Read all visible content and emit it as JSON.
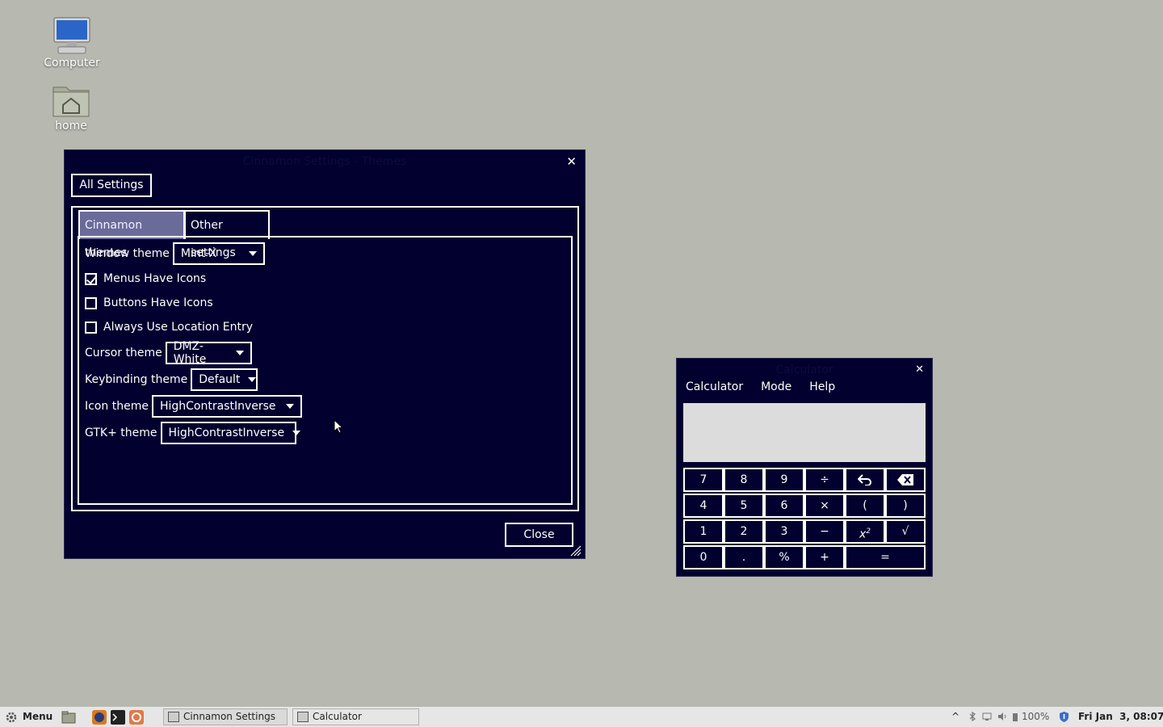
{
  "desktop": {
    "icons": [
      {
        "label": "Computer",
        "icon": "computer-icon"
      },
      {
        "label": "home",
        "icon": "home-folder-icon"
      }
    ]
  },
  "settings_window": {
    "title": "Cinnamon Settings - Themes",
    "all_settings_label": "All Settings",
    "tabs": [
      {
        "label": "Cinnamon themes",
        "active": true
      },
      {
        "label": "Other settings",
        "active": false
      }
    ],
    "window_theme": {
      "label": "Window theme",
      "value": "Mint-X"
    },
    "checkboxes": [
      {
        "label": "Menus Have Icons",
        "checked": true
      },
      {
        "label": "Buttons Have Icons",
        "checked": false
      },
      {
        "label": "Always Use Location Entry",
        "checked": false
      }
    ],
    "cursor_theme": {
      "label": "Cursor theme",
      "value": "DMZ-White"
    },
    "keybinding_theme": {
      "label": "Keybinding theme",
      "value": "Default"
    },
    "icon_theme": {
      "label": "Icon theme",
      "value": "HighContrastInverse"
    },
    "gtk_theme": {
      "label": "GTK+ theme",
      "value": "HighContrastInverse"
    },
    "close_label": "Close"
  },
  "calculator": {
    "title": "Calculator",
    "menus": [
      "Calculator",
      "Mode",
      "Help"
    ],
    "display_value": "",
    "keys": {
      "k7": "7",
      "k8": "8",
      "k9": "9",
      "div": "÷",
      "k4": "4",
      "k5": "5",
      "k6": "6",
      "mul": "×",
      "lparen": "(",
      "rparen": ")",
      "k1": "1",
      "k2": "2",
      "k3": "3",
      "sub": "−",
      "sqrt": "√",
      "k0": "0",
      "dot": ".",
      "pct": "%",
      "add": "+",
      "eq": "="
    }
  },
  "taskbar": {
    "menu_label": "Menu",
    "tasks": [
      {
        "label": "Cinnamon Settings -...",
        "icon": "settings-icon"
      },
      {
        "label": "Calculator",
        "icon": "calculator-icon"
      }
    ],
    "battery": "100%",
    "clock": "Fri Jan  3, 08:07"
  },
  "colors": {
    "desktop_bg": "#b7b9b0",
    "window_bg": "#02002e",
    "active_tab": "#6b6b9a",
    "taskbar_bg": "#e6e6e6"
  }
}
